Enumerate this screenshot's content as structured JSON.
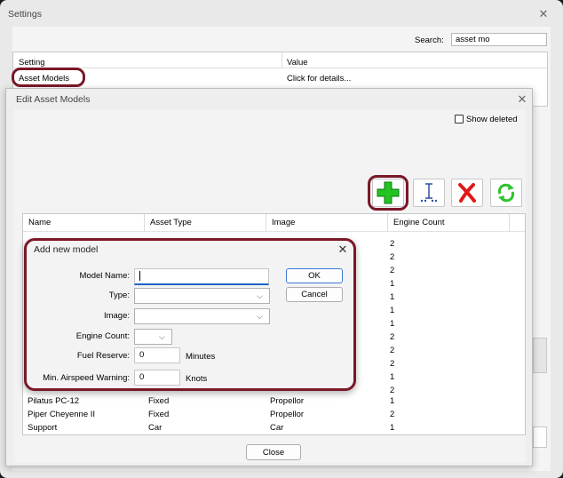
{
  "settings": {
    "title": "Settings",
    "search_label": "Search:",
    "search_value": "asset mo",
    "col_setting": "Setting",
    "col_value": "Value",
    "row_setting": "Asset Models",
    "row_value": "Click for details..."
  },
  "edit_dialog": {
    "title": "Edit Asset Models",
    "show_deleted_label": "Show deleted",
    "show_deleted_checked": false,
    "columns": [
      "Name",
      "Asset Type",
      "Image",
      "Engine Count"
    ],
    "engine_counts_top": [
      "2",
      "2",
      "2",
      "1",
      "1",
      "1",
      "1",
      "2",
      "2",
      "2",
      "1",
      "2"
    ],
    "rows": [
      {
        "name": "Pilatus PC-12",
        "type": "Fixed",
        "image": "Propellor",
        "engines": "1"
      },
      {
        "name": "Piper Cheyenne II",
        "type": "Fixed",
        "image": "Propellor",
        "engines": "2"
      },
      {
        "name": "Support",
        "type": "Car",
        "image": "Car",
        "engines": "1"
      }
    ],
    "close_label": "Close",
    "accent": "#7a1828"
  },
  "add_dialog": {
    "title": "Add new model",
    "model_name_label": "Model Name:",
    "model_name_value": "",
    "type_label": "Type:",
    "image_label": "Image:",
    "engine_count_label": "Engine Count:",
    "fuel_reserve_label": "Fuel Reserve:",
    "fuel_reserve_value": "0",
    "fuel_reserve_unit": "Minutes",
    "min_airspeed_label": "Min. Airspeed Warning:",
    "min_airspeed_value": "0",
    "min_airspeed_unit": "Knots",
    "ok_label": "OK",
    "cancel_label": "Cancel"
  }
}
